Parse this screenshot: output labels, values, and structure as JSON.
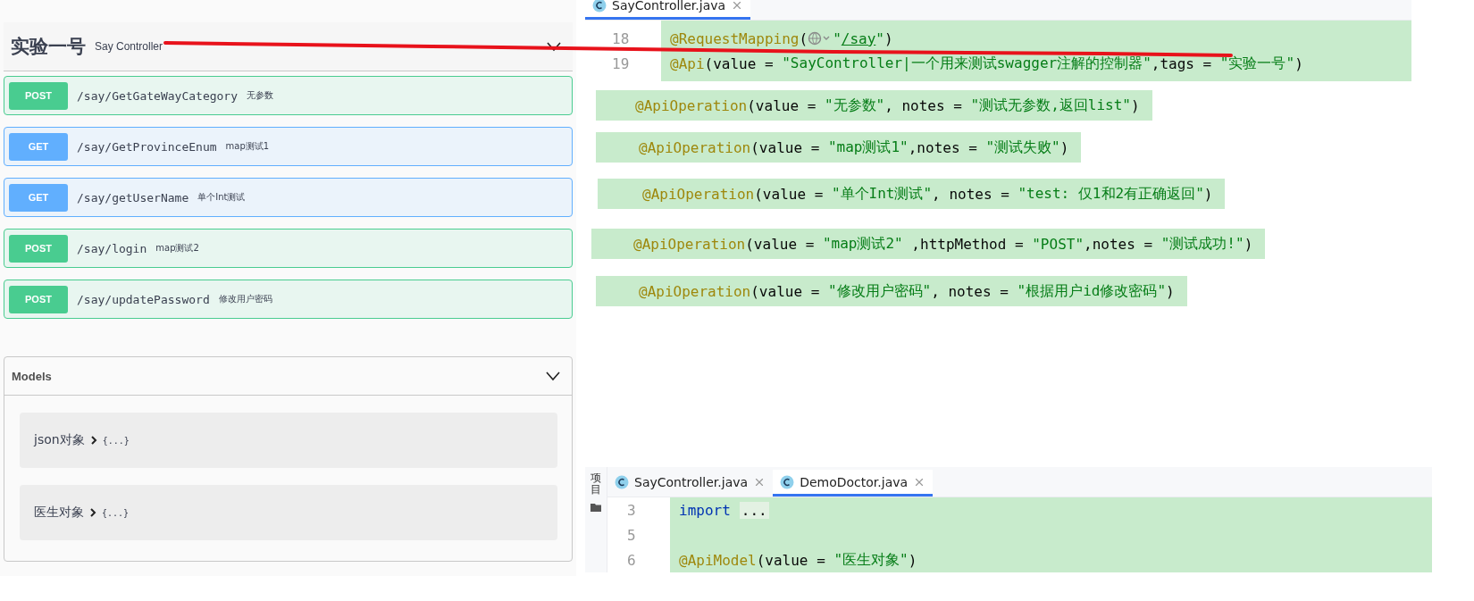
{
  "api_group": {
    "title": "实验一号",
    "description": "Say Controller",
    "expanded": true
  },
  "operations": [
    {
      "method": "POST",
      "path": "/say/GetGateWayCategory",
      "summary": "无参数"
    },
    {
      "method": "GET",
      "path": "/say/GetProvinceEnum",
      "summary": "map测试1"
    },
    {
      "method": "GET",
      "path": "/say/getUserName",
      "summary": "单个Int测试"
    },
    {
      "method": "POST",
      "path": "/say/login",
      "summary": "map测试2"
    },
    {
      "method": "POST",
      "path": "/say/updatePassword",
      "summary": "修改用户密码"
    }
  ],
  "models": {
    "title": "Models",
    "expanded": true,
    "items": [
      {
        "name": "json对象",
        "preview": "{...}"
      },
      {
        "name": "医生对象",
        "preview": "{...}"
      }
    ]
  },
  "editor_top": {
    "tabs": [
      {
        "label": "SayController.java",
        "selected": true
      }
    ],
    "lines": [
      {
        "number": "18",
        "tokens": [
          {
            "kind": "annotation",
            "text": "@RequestMapping"
          },
          {
            "kind": "plain",
            "text": "("
          },
          {
            "kind": "globe"
          },
          {
            "kind": "string",
            "text": "\""
          },
          {
            "kind": "link",
            "text": "/say"
          },
          {
            "kind": "string",
            "text": "\""
          },
          {
            "kind": "plain",
            "text": ")"
          }
        ]
      },
      {
        "number": "19",
        "tokens": [
          {
            "kind": "annotation",
            "text": "@Api"
          },
          {
            "kind": "plain",
            "text": "(value = "
          },
          {
            "kind": "string",
            "text": "\"SayController|一个用来测试swagger注解的控制器\""
          },
          {
            "kind": "plain",
            "text": ",tags = "
          },
          {
            "kind": "string",
            "text": "\"实验一号\""
          },
          {
            "kind": "plain",
            "text": ")"
          }
        ]
      }
    ]
  },
  "snippets": [
    {
      "tokens": [
        {
          "kind": "annotation",
          "text": "@ApiOperation"
        },
        {
          "kind": "plain",
          "text": "(value = "
        },
        {
          "kind": "string",
          "text": "\"无参数\""
        },
        {
          "kind": "plain",
          "text": ", notes = "
        },
        {
          "kind": "string",
          "text": "\"测试无参数,返回list\""
        },
        {
          "kind": "plain",
          "text": ")"
        }
      ]
    },
    {
      "tokens": [
        {
          "kind": "annotation",
          "text": "@ApiOperation"
        },
        {
          "kind": "plain",
          "text": "(value = "
        },
        {
          "kind": "string",
          "text": "\"map测试1\""
        },
        {
          "kind": "plain",
          "text": ",notes = "
        },
        {
          "kind": "string",
          "text": "\"测试失败\""
        },
        {
          "kind": "plain",
          "text": ")"
        }
      ]
    },
    {
      "tokens": [
        {
          "kind": "annotation",
          "text": "@ApiOperation"
        },
        {
          "kind": "plain",
          "text": "(value = "
        },
        {
          "kind": "string",
          "text": "\"单个Int测试\""
        },
        {
          "kind": "plain",
          "text": ", notes = "
        },
        {
          "kind": "string",
          "text": "\"test: 仅1和2有正确返回\""
        },
        {
          "kind": "plain",
          "text": ")"
        }
      ]
    },
    {
      "tokens": [
        {
          "kind": "annotation",
          "text": "@ApiOperation"
        },
        {
          "kind": "plain",
          "text": "(value = "
        },
        {
          "kind": "string",
          "text": "\"map测试2\""
        },
        {
          "kind": "plain",
          "text": " ,httpMethod = "
        },
        {
          "kind": "string",
          "text": "\"POST\""
        },
        {
          "kind": "plain",
          "text": ",notes = "
        },
        {
          "kind": "string",
          "text": "\"测试成功!\""
        },
        {
          "kind": "plain",
          "text": ")"
        }
      ]
    },
    {
      "tokens": [
        {
          "kind": "annotation",
          "text": "@ApiOperation"
        },
        {
          "kind": "plain",
          "text": "(value = "
        },
        {
          "kind": "string",
          "text": "\"修改用户密码\""
        },
        {
          "kind": "plain",
          "text": ", notes = "
        },
        {
          "kind": "string",
          "text": "\"根据用户id修改密码\""
        },
        {
          "kind": "plain",
          "text": ")"
        }
      ]
    }
  ],
  "editor_bottom": {
    "side_label": "项目",
    "tabs": [
      {
        "label": "SayController.java",
        "selected": false
      },
      {
        "label": "DemoDoctor.java",
        "selected": true
      }
    ],
    "lines": [
      {
        "number": "3",
        "tokens": [
          {
            "kind": "keyword",
            "text": "import"
          },
          {
            "kind": "fold",
            "text": "..."
          }
        ]
      },
      {
        "number": "5"
      },
      {
        "number": "6",
        "tokens": [
          {
            "kind": "annotation",
            "text": "@ApiModel"
          },
          {
            "kind": "plain",
            "text": "(value = "
          },
          {
            "kind": "string",
            "text": "\"医生对象\""
          },
          {
            "kind": "plain",
            "text": ")"
          }
        ]
      }
    ]
  }
}
